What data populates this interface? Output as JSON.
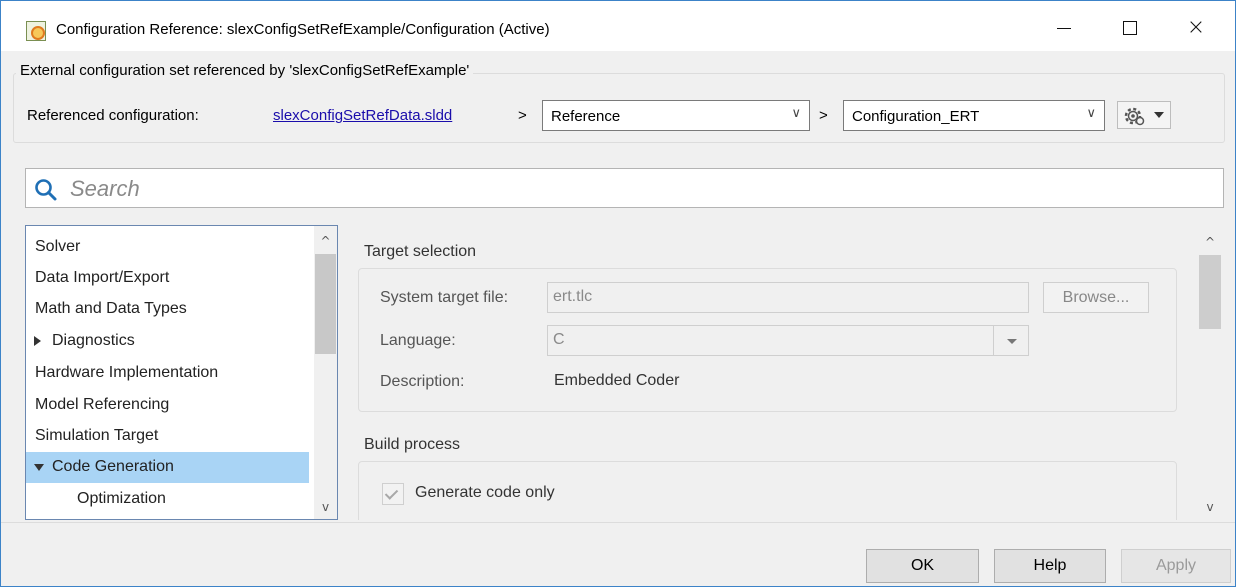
{
  "window": {
    "title": "Configuration Reference: slexConfigSetRefExample/Configuration (Active)",
    "icon": "simulink-config-icon",
    "controls": {
      "minimize": "minimize-icon",
      "maximize": "maximize-icon",
      "close": "×"
    }
  },
  "external_group": {
    "legend": "External configuration set referenced by 'slexConfigSetRefExample'",
    "referenced_label": "Referenced configuration:",
    "data_dictionary_link": "slexConfigSetRefData.sldd",
    "separator": ">",
    "variable_select": {
      "value": "Reference",
      "chevron": "∨"
    },
    "configuration_select": {
      "value": "Configuration_ERT",
      "chevron": "∨"
    },
    "gear_menu": "gear-icon"
  },
  "search": {
    "placeholder": "Search",
    "icon": "search-icon"
  },
  "tree": {
    "items": [
      {
        "label": "Solver",
        "indent": 0,
        "arrow": ""
      },
      {
        "label": "Data Import/Export",
        "indent": 0,
        "arrow": ""
      },
      {
        "label": "Math and Data Types",
        "indent": 0,
        "arrow": ""
      },
      {
        "label": "Diagnostics",
        "indent": 0,
        "arrow": "collapsed"
      },
      {
        "label": "Hardware Implementation",
        "indent": 0,
        "arrow": ""
      },
      {
        "label": "Model Referencing",
        "indent": 0,
        "arrow": ""
      },
      {
        "label": "Simulation Target",
        "indent": 0,
        "arrow": ""
      },
      {
        "label": "Code Generation",
        "indent": 0,
        "arrow": "expanded",
        "selected": true
      },
      {
        "label": "Optimization",
        "indent": 1,
        "arrow": ""
      }
    ],
    "scroll_up": "^",
    "scroll_down": "v"
  },
  "target_selection": {
    "title": "Target selection",
    "system_target_label": "System target file:",
    "system_target_value": "ert.tlc",
    "browse_label": "Browse...",
    "language_label": "Language:",
    "language_value": "C",
    "description_label": "Description:",
    "description_value": "Embedded Coder"
  },
  "build_process": {
    "title": "Build process",
    "generate_code_only_label": "Generate code only",
    "generate_code_only_checked": true
  },
  "panel_scroll": {
    "up": "^",
    "down": "v"
  },
  "buttons": {
    "ok": "OK",
    "help": "Help",
    "apply": "Apply"
  }
}
